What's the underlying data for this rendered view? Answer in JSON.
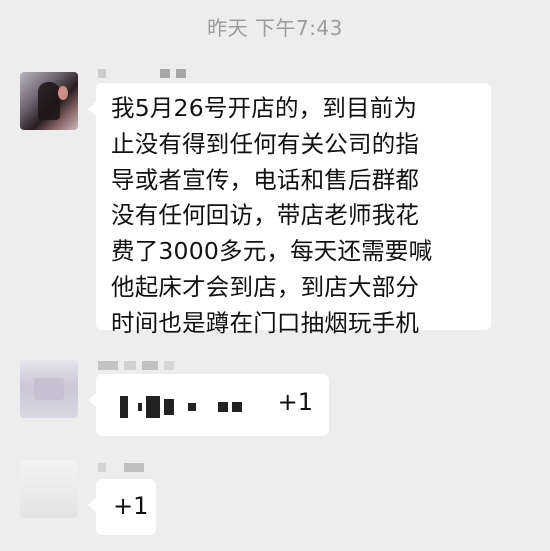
{
  "chat": {
    "timestamp": "昨天 下午7:43",
    "messages": [
      {
        "text": "我5月26号开店的，到目前为\n止没有得到任何有关公司的指\n导或者宣传，电话和售后群都\n没有任何回访，带店老师我花\n费了3000多元，每天还需要喊\n他起床才会到店，到店大部分\n时间也是蹲在门口抽烟玩手机"
      },
      {
        "text": "+1"
      },
      {
        "text": "+1"
      }
    ]
  },
  "colors": {
    "background": "#ededed",
    "bubble": "#ffffff",
    "timestamp": "#9c9c9c",
    "text": "#111111"
  },
  "icons": {
    "avatar_1": "blurred-avatar",
    "avatar_2": "blurred-avatar",
    "avatar_3": "blurred-avatar"
  }
}
